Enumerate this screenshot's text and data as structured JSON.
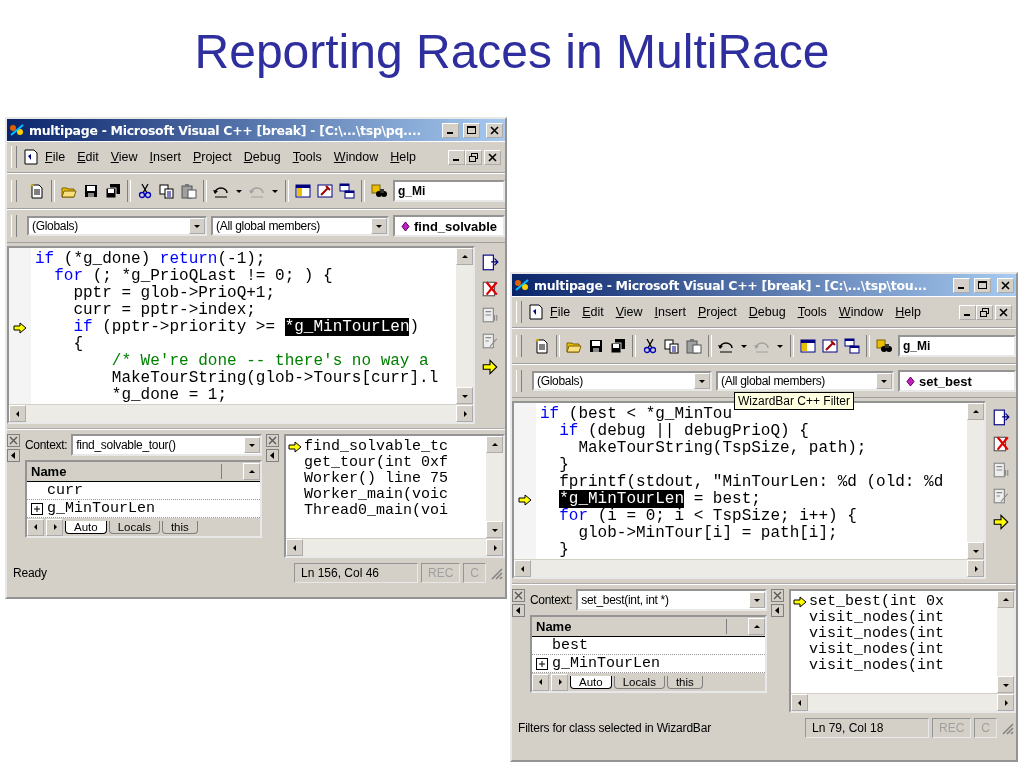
{
  "slide_title": "Reporting Races in MultiRace",
  "windows": [
    {
      "title": "multipage - Microsoft Visual C++ [break] - [C:\\...\\tsp\\pq....",
      "menu": [
        "File",
        "Edit",
        "View",
        "Insert",
        "Project",
        "Debug",
        "Tools",
        "Window",
        "Help"
      ],
      "find_box": {
        "value": "g_Mi"
      },
      "wizard_bar": {
        "class_filter": "(Globals)",
        "member_filter": "(All global members)",
        "member": "find_solvable"
      },
      "code": [
        {
          "current": false,
          "segments": [
            {
              "kind": "keyword",
              "text": "if"
            },
            {
              "kind": "plain",
              "text": " (*g_done) "
            },
            {
              "kind": "keyword",
              "text": "return"
            },
            {
              "kind": "plain",
              "text": "(-1);"
            }
          ]
        },
        {
          "current": false,
          "segments": [
            {
              "kind": "keyword",
              "text": "  for"
            },
            {
              "kind": "plain",
              "text": " (; *g_PrioQLast != 0; ) {"
            }
          ]
        },
        {
          "current": false,
          "segments": [
            {
              "kind": "plain",
              "text": "    pptr = glob->PrioQ+1;"
            }
          ]
        },
        {
          "current": false,
          "segments": [
            {
              "kind": "plain",
              "text": "    curr = pptr->index;"
            }
          ]
        },
        {
          "current": true,
          "segments": [
            {
              "kind": "keyword",
              "text": "    if"
            },
            {
              "kind": "plain",
              "text": " (pptr->priority >= "
            },
            {
              "kind": "highlight",
              "text": "*g_MinTourLen"
            },
            {
              "kind": "plain",
              "text": ")"
            }
          ]
        },
        {
          "current": false,
          "segments": [
            {
              "kind": "plain",
              "text": "    {"
            }
          ]
        },
        {
          "current": false,
          "segments": [
            {
              "kind": "comment",
              "text": "        /* We're done -- there's no way a"
            }
          ]
        },
        {
          "current": false,
          "segments": [
            {
              "kind": "plain",
              "text": "        MakeTourString(glob->Tours[curr].l"
            }
          ]
        },
        {
          "current": false,
          "segments": [
            {
              "kind": "plain",
              "text": "        *g_done = 1;"
            }
          ]
        }
      ],
      "variables": {
        "context_label": "Context:",
        "context": "find_solvable_tour()",
        "column": "Name",
        "rows": [
          {
            "name": "curr",
            "expandable": false
          },
          {
            "name": "g_MinTourLen",
            "expandable": true
          }
        ],
        "tabs": [
          {
            "label": "Auto",
            "selected": true
          },
          {
            "label": "Locals",
            "selected": false
          },
          {
            "label": "this",
            "selected": false
          }
        ]
      },
      "call_stack": [
        {
          "text": "find_solvable_tc",
          "current": true
        },
        {
          "text": "get_tour(int 0xf",
          "current": false
        },
        {
          "text": "Worker() line 75",
          "current": false
        },
        {
          "text": "Worker_main(voic",
          "current": false
        },
        {
          "text": "Thread0_main(voi",
          "current": false
        }
      ],
      "status_bar": {
        "message": "Ready",
        "position": "Ln 156, Col 46",
        "indicators": [
          {
            "label": "REC",
            "on": false
          },
          {
            "label": "C",
            "on": false
          }
        ]
      }
    },
    {
      "title": "multipage - Microsoft Visual C++ [break] - [C:\\...\\tsp\\tou...",
      "menu": [
        "File",
        "Edit",
        "View",
        "Insert",
        "Project",
        "Debug",
        "Tools",
        "Window",
        "Help"
      ],
      "find_box": {
        "value": "g_Mi"
      },
      "wizard_bar": {
        "class_filter": "(Globals)",
        "member_filter": "(All global members)",
        "member": "set_best"
      },
      "tooltip": "WizardBar C++ Filter",
      "code": [
        {
          "current": false,
          "segments": [
            {
              "kind": "keyword",
              "text": "if"
            },
            {
              "kind": "plain",
              "text": " (best < *g_MinTou"
            }
          ]
        },
        {
          "current": false,
          "segments": [
            {
              "kind": "keyword",
              "text": "  if"
            },
            {
              "kind": "plain",
              "text": " (debug || debugPrioQ) {"
            }
          ]
        },
        {
          "current": false,
          "segments": [
            {
              "kind": "plain",
              "text": "    MakeTourString(TspSize, path);"
            }
          ]
        },
        {
          "current": false,
          "segments": [
            {
              "kind": "plain",
              "text": "  }"
            }
          ]
        },
        {
          "current": false,
          "segments": [
            {
              "kind": "plain",
              "text": "  fprintf(stdout, \"MinTourLen: %d (old: %d"
            }
          ]
        },
        {
          "current": true,
          "segments": [
            {
              "kind": "highlight",
              "text": "  *g_MinTourLen"
            },
            {
              "kind": "plain",
              "text": " = best;"
            }
          ]
        },
        {
          "current": false,
          "segments": [
            {
              "kind": "keyword",
              "text": "  for"
            },
            {
              "kind": "plain",
              "text": " (i = 0; i < TspSize; i++) {"
            }
          ]
        },
        {
          "current": false,
          "segments": [
            {
              "kind": "plain",
              "text": "    glob->MinTour[i] = path[i];"
            }
          ]
        },
        {
          "current": false,
          "segments": [
            {
              "kind": "plain",
              "text": "  }"
            }
          ]
        }
      ],
      "variables": {
        "context_label": "Context:",
        "context": "set_best(int, int *)",
        "column": "Name",
        "rows": [
          {
            "name": "best",
            "expandable": false
          },
          {
            "name": "g_MinTourLen",
            "expandable": true
          }
        ],
        "tabs": [
          {
            "label": "Auto",
            "selected": true
          },
          {
            "label": "Locals",
            "selected": false
          },
          {
            "label": "this",
            "selected": false
          }
        ]
      },
      "call_stack": [
        {
          "text": "set_best(int 0x",
          "current": true
        },
        {
          "text": "visit_nodes(int",
          "current": false
        },
        {
          "text": "visit_nodes(int",
          "current": false
        },
        {
          "text": "visit_nodes(int",
          "current": false
        },
        {
          "text": "visit_nodes(int",
          "current": false
        }
      ],
      "status_bar": {
        "message": "Filters for class selected in WizardBar",
        "position": "Ln 79, Col 18",
        "indicators": [
          {
            "label": "REC",
            "on": false
          },
          {
            "label": "C",
            "on": false
          }
        ]
      }
    }
  ]
}
